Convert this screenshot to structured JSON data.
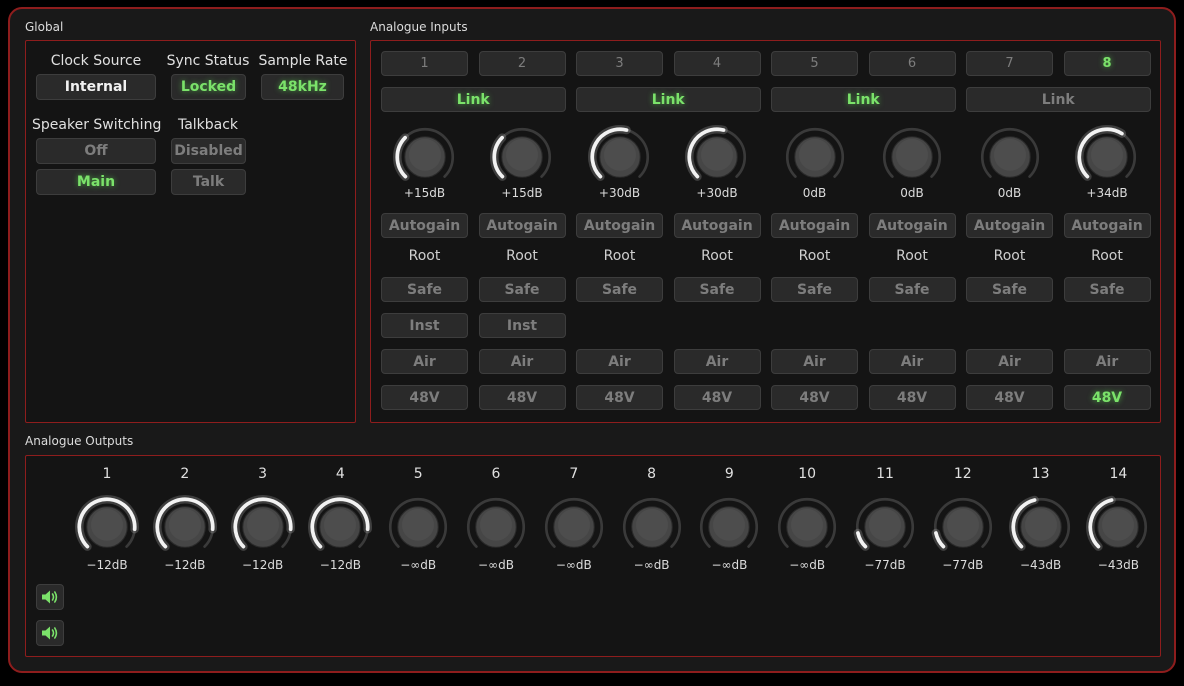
{
  "global": {
    "title": "Global",
    "clock_source": {
      "label": "Clock Source",
      "value": "Internal"
    },
    "sync_status": {
      "label": "Sync Status",
      "value": "Locked"
    },
    "sample_rate": {
      "label": "Sample Rate",
      "value": "48kHz"
    },
    "speaker_switching": {
      "label": "Speaker Switching",
      "off": "Off",
      "main": "Main"
    },
    "talkback": {
      "label": "Talkback",
      "disabled": "Disabled",
      "talk": "Talk"
    }
  },
  "inputs": {
    "title": "Analogue Inputs",
    "channels": [
      {
        "label": "1",
        "selected": false,
        "gain_db": "+15dB",
        "level": 0.33,
        "autogain": "Autogain",
        "root": "Root",
        "safe": "Safe",
        "inst": "Inst",
        "air": "Air",
        "phantom": "48V",
        "phantom_on": false
      },
      {
        "label": "2",
        "selected": false,
        "gain_db": "+15dB",
        "level": 0.33,
        "autogain": "Autogain",
        "root": "Root",
        "safe": "Safe",
        "inst": "Inst",
        "air": "Air",
        "phantom": "48V",
        "phantom_on": false
      },
      {
        "label": "3",
        "selected": false,
        "gain_db": "+30dB",
        "level": 0.55,
        "autogain": "Autogain",
        "root": "Root",
        "safe": "Safe",
        "inst": null,
        "air": "Air",
        "phantom": "48V",
        "phantom_on": false
      },
      {
        "label": "4",
        "selected": false,
        "gain_db": "+30dB",
        "level": 0.55,
        "autogain": "Autogain",
        "root": "Root",
        "safe": "Safe",
        "inst": null,
        "air": "Air",
        "phantom": "48V",
        "phantom_on": false
      },
      {
        "label": "5",
        "selected": false,
        "gain_db": "0dB",
        "level": 0.0,
        "autogain": "Autogain",
        "root": "Root",
        "safe": "Safe",
        "inst": null,
        "air": "Air",
        "phantom": "48V",
        "phantom_on": false
      },
      {
        "label": "6",
        "selected": false,
        "gain_db": "0dB",
        "level": 0.0,
        "autogain": "Autogain",
        "root": "Root",
        "safe": "Safe",
        "inst": null,
        "air": "Air",
        "phantom": "48V",
        "phantom_on": false
      },
      {
        "label": "7",
        "selected": false,
        "gain_db": "0dB",
        "level": 0.0,
        "autogain": "Autogain",
        "root": "Root",
        "safe": "Safe",
        "inst": null,
        "air": "Air",
        "phantom": "48V",
        "phantom_on": false
      },
      {
        "label": "8",
        "selected": true,
        "gain_db": "+34dB",
        "level": 0.62,
        "autogain": "Autogain",
        "root": "Root",
        "safe": "Safe",
        "inst": null,
        "air": "Air",
        "phantom": "48V",
        "phantom_on": true
      }
    ],
    "links": [
      {
        "label": "Link",
        "on": true
      },
      {
        "label": "Link",
        "on": true
      },
      {
        "label": "Link",
        "on": true
      },
      {
        "label": "Link",
        "on": false
      }
    ]
  },
  "outputs": {
    "title": "Analogue Outputs",
    "channels": [
      {
        "label": "1",
        "value": "−12dB",
        "level": 0.85
      },
      {
        "label": "2",
        "value": "−12dB",
        "level": 0.85
      },
      {
        "label": "3",
        "value": "−12dB",
        "level": 0.85
      },
      {
        "label": "4",
        "value": "−12dB",
        "level": 0.85
      },
      {
        "label": "5",
        "value": "−∞dB",
        "level": 0.0
      },
      {
        "label": "6",
        "value": "−∞dB",
        "level": 0.0
      },
      {
        "label": "7",
        "value": "−∞dB",
        "level": 0.0
      },
      {
        "label": "8",
        "value": "−∞dB",
        "level": 0.0
      },
      {
        "label": "9",
        "value": "−∞dB",
        "level": 0.0
      },
      {
        "label": "10",
        "value": "−∞dB",
        "level": 0.0
      },
      {
        "label": "11",
        "value": "−77dB",
        "level": 0.12
      },
      {
        "label": "12",
        "value": "−77dB",
        "level": 0.12
      },
      {
        "label": "13",
        "value": "−43dB",
        "level": 0.45
      },
      {
        "label": "14",
        "value": "−43dB",
        "level": 0.45
      }
    ],
    "speaker_icons": [
      "speaker-icon",
      "speaker-icon"
    ]
  },
  "colors": {
    "accent_red": "#8e1d1d",
    "on_green": "#7be26a",
    "knob_arc": "#f2f2f2"
  }
}
